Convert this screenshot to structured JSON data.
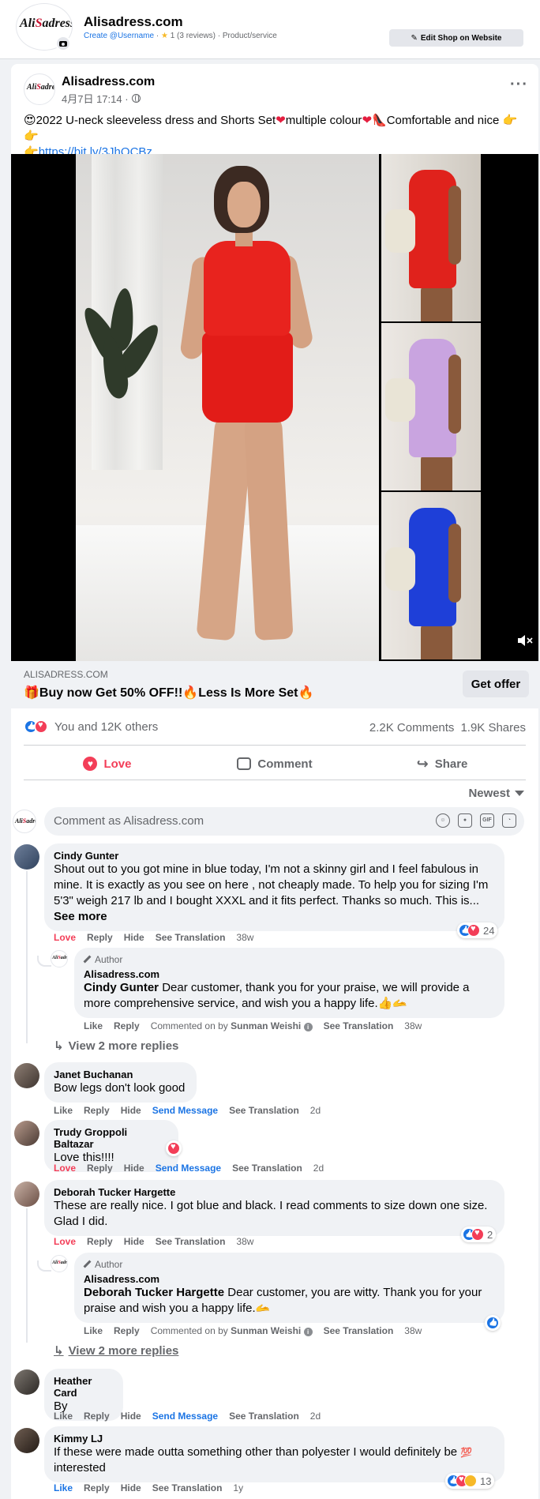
{
  "page_header": {
    "name": "Alisadress.com",
    "logo_prefix": "Ali",
    "logo_suffix": "adress",
    "create_username": "Create @Username",
    "rating": "1 (3 reviews)",
    "category": "Product/service",
    "edit_shop_label": "Edit Shop on Website"
  },
  "post": {
    "author": "Alisadress.com",
    "timestamp": "4月7日 17:14 ·",
    "text": "2022 U-neck sleeveless dress and Shorts Set",
    "text_mid": "multiple colour",
    "text_end": "Comfortable and nice",
    "link": "https://bit.ly/3JhQCBz"
  },
  "link_preview": {
    "domain": "ALISADRESS.COM",
    "title": "Buy now Get 50% OFF!!",
    "title_end": "Less Is More Set",
    "cta": "Get offer"
  },
  "reactions_summary": {
    "people": "You and 12K others",
    "comments": "2.2K Comments",
    "shares": "1.9K Shares"
  },
  "actions": {
    "love": "Love",
    "comment": "Comment",
    "share": "Share"
  },
  "sort_label": "Newest",
  "composer": {
    "placeholder": "Comment as Alisadress.com"
  },
  "comments": [
    {
      "name": "Cindy Gunter",
      "text": "Shout out to you got mine in blue today, I'm not a skinny girl and I feel fabulous in mine. It is exactly as you see on here , not cheaply made. To help you for sizing I'm 5'3\" weigh 217 lb and I bought XXXL and it fits perfect. Thanks so much. This is...",
      "see_more": "See more",
      "actions": [
        "Love",
        "Reply",
        "Hide",
        "See Translation"
      ],
      "time": "38w",
      "reaction_count": "24"
    },
    {
      "author_tag": "Author",
      "name": "Alisadress.com",
      "mention": "Cindy Gunter",
      "text": "Dear customer, thank you for your praise, we will provide a more comprehensive service, and wish you a happy life.",
      "actions": [
        "Like",
        "Reply"
      ],
      "commented_on_by": "Commented on by",
      "commenter": "Sunman Weishi",
      "translate": "See Translation",
      "time": "38w"
    },
    {
      "view_more": "View 2 more replies"
    },
    {
      "name": "Janet Buchanan",
      "text": "Bow legs don't look good",
      "actions": [
        "Like",
        "Reply",
        "Hide"
      ],
      "send_message": "Send Message",
      "translate": "See Translation",
      "time": "2d"
    },
    {
      "name": "Trudy Groppoli Baltazar",
      "text": "Love this!!!!",
      "actions": [
        "Love",
        "Reply",
        "Hide"
      ],
      "send_message": "Send Message",
      "translate": "See Translation",
      "time": "2d"
    },
    {
      "name": "Deborah Tucker Hargette",
      "text": "These are really nice. I got blue and black. I read comments to size down one size. Glad I did.",
      "actions": [
        "Love",
        "Reply",
        "Hide",
        "See Translation"
      ],
      "time": "38w",
      "reaction_count": "2"
    },
    {
      "author_tag": "Author",
      "name": "Alisadress.com",
      "mention": "Deborah Tucker Hargette",
      "text": "Dear customer, you are witty. Thank you for your praise and wish you a happy life.",
      "actions": [
        "Like",
        "Reply"
      ],
      "commented_on_by": "Commented on by",
      "commenter": "Sunman Weishi",
      "translate": "See Translation",
      "time": "38w"
    },
    {
      "view_more": "View 2 more replies"
    },
    {
      "name": "Heather Card",
      "text": "By",
      "actions": [
        "Like",
        "Reply",
        "Hide"
      ],
      "send_message": "Send Message",
      "translate": "See Translation",
      "time": "2d"
    },
    {
      "name": "Kimmy LJ",
      "text": "If these were made outta something other than polyester I would definitely be",
      "text_end": "interested",
      "actions": [
        "Like",
        "Reply",
        "Hide",
        "See Translation"
      ],
      "time": "1y",
      "reaction_count": "13"
    }
  ],
  "colors": {
    "accent_blue": "#1b74e4",
    "love_red": "#f33e58",
    "dress_red": "#e8231e",
    "dress_lilac": "#c9a4e0",
    "dress_blue": "#1e3fd8"
  }
}
